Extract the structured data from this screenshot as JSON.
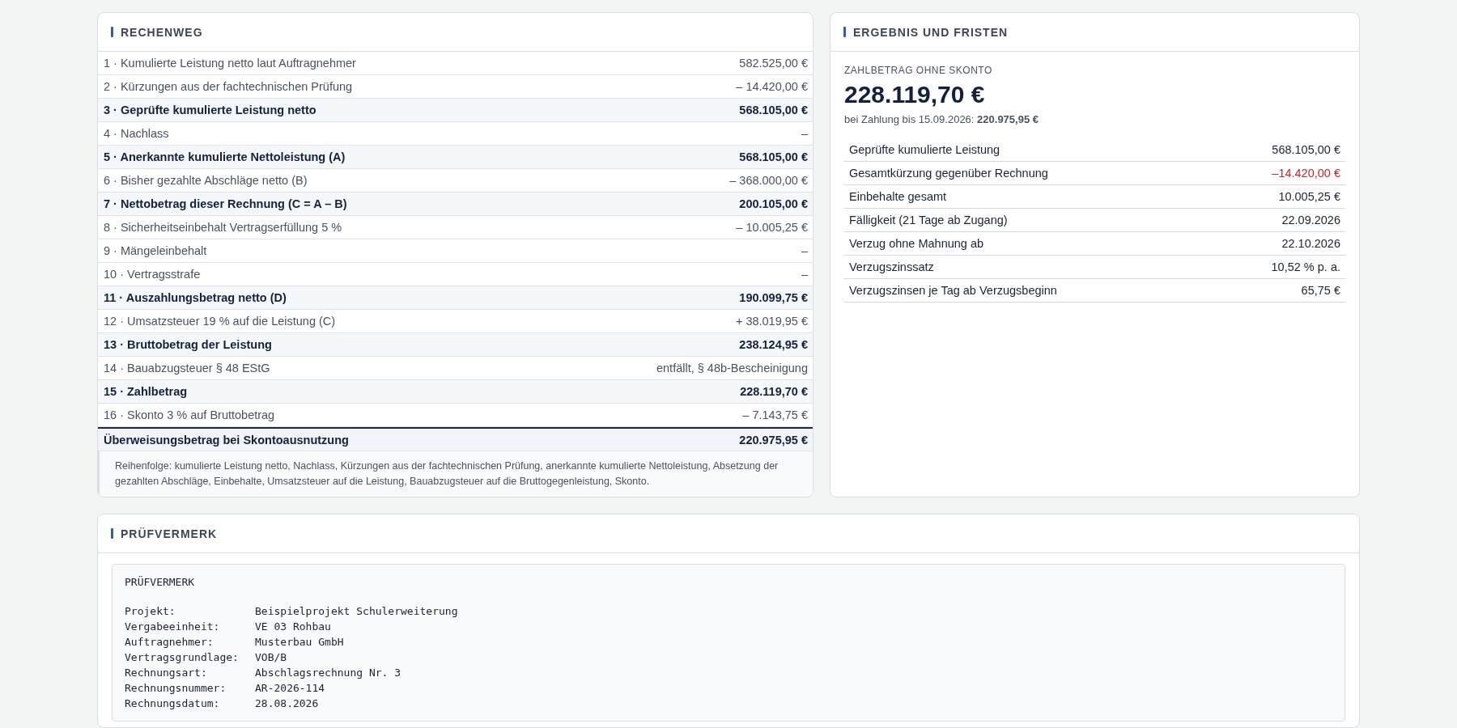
{
  "calculation": {
    "title": "RECHENWEG",
    "rows": [
      {
        "label": "1 · Kumulierte Leistung netto laut Auftragnehmer",
        "value": "582.525,00 €",
        "kind": "normal"
      },
      {
        "label": "2 · Kürzungen aus der fachtechnischen Prüfung",
        "value": "– 14.420,00 €",
        "kind": "normal"
      },
      {
        "label": "3 · Geprüfte kumulierte Leistung netto",
        "value": "568.105,00 €",
        "kind": "subtotal"
      },
      {
        "label": "4 · Nachlass",
        "value": "–",
        "kind": "normal"
      },
      {
        "label": "5 · Anerkannte kumulierte Nettoleistung (A)",
        "value": "568.105,00 €",
        "kind": "subtotal"
      },
      {
        "label": "6 · Bisher gezahlte Abschläge netto (B)",
        "value": "– 368.000,00 €",
        "kind": "normal"
      },
      {
        "label": "7 · Nettobetrag dieser Rechnung (C = A – B)",
        "value": "200.105,00 €",
        "kind": "subtotal"
      },
      {
        "label": "8 · Sicherheitseinbehalt Vertragserfüllung 5 %",
        "value": "– 10.005,25 €",
        "kind": "normal"
      },
      {
        "label": "9 · Mängeleinbehalt",
        "value": "–",
        "kind": "normal"
      },
      {
        "label": "10 · Vertragsstrafe",
        "value": "–",
        "kind": "normal"
      },
      {
        "label": "11 · Auszahlungsbetrag netto (D)",
        "value": "190.099,75 €",
        "kind": "subtotal"
      },
      {
        "label": "12 · Umsatzsteuer 19 % auf die Leistung (C)",
        "value": "+ 38.019,95 €",
        "kind": "normal"
      },
      {
        "label": "13 · Bruttobetrag der Leistung",
        "value": "238.124,95 €",
        "kind": "subtotal"
      },
      {
        "label": "14 · Bauabzugsteuer § 48 EStG",
        "value": "entfällt, § 48b-Bescheinigung",
        "kind": "normal"
      },
      {
        "label": "15 · Zahlbetrag",
        "value": "228.119,70 €",
        "kind": "subtotal"
      },
      {
        "label": "16 · Skonto 3 % auf Bruttobetrag",
        "value": "– 7.143,75 €",
        "kind": "normal"
      },
      {
        "label": "Überweisungsbetrag bei Skontoausnutzung",
        "value": "220.975,95 €",
        "kind": "total"
      }
    ],
    "note": "Reihenfolge: kumulierte Leistung netto, Nachlass, Kürzungen aus der fachtechnischen Prüfung, anerkannte kumulierte Nettoleistung, Absetzung der gezahlten Abschläge, Einbehalte, Umsatzsteuer auf die Leistung, Bauabzugsteuer auf die Bruttogegenleistung, Skonto."
  },
  "result": {
    "title": "ERGEBNIS UND FRISTEN",
    "amount_label": "ZAHLBETRAG OHNE SKONTO",
    "amount": "228.119,70 €",
    "discount_note": "bei Zahlung bis 15.09.2026: **220.975,95 €**",
    "rows": [
      {
        "label": "Geprüfte kumulierte Leistung",
        "value": "568.105,00 €",
        "kind": "plain"
      },
      {
        "label": "Gesamtkürzung gegenüber Rechnung",
        "value": "–14.420,00 €",
        "kind": "negative"
      },
      {
        "label": "Einbehalte gesamt",
        "value": "10.005,25 €",
        "kind": "plain"
      },
      {
        "label": "Fälligkeit (21 Tage ab Zugang)",
        "value": "22.09.2026",
        "kind": "plain"
      },
      {
        "label": "Verzug ohne Mahnung ab",
        "value": "22.10.2026",
        "kind": "plain"
      },
      {
        "label": "Verzugszinssatz",
        "value": "10,52 % p. a.",
        "kind": "plain"
      },
      {
        "label": "Verzugszinsen je Tag ab Verzugsbeginn",
        "value": "65,75 €",
        "kind": "plain"
      }
    ]
  },
  "review_note": {
    "title": "PRÜFVERMERK",
    "heading": "PRÜFVERMERK",
    "lines": [
      {
        "label": "Projekt:",
        "value": "Beispielprojekt Schulerweiterung"
      },
      {
        "label": "Vergabeeinheit:",
        "value": "VE 03 Rohbau"
      },
      {
        "label": "Auftragnehmer:",
        "value": "Musterbau GmbH"
      },
      {
        "label": "Vertragsgrundlage:",
        "value": "VOB/B"
      },
      {
        "label": "Rechnungsart:",
        "value": "Abschlagsrechnung Nr. 3"
      },
      {
        "label": "Rechnungsnummer:",
        "value": "AR-2026-114"
      },
      {
        "label": "Rechnungsdatum:",
        "value": "28.08.2026"
      }
    ]
  }
}
